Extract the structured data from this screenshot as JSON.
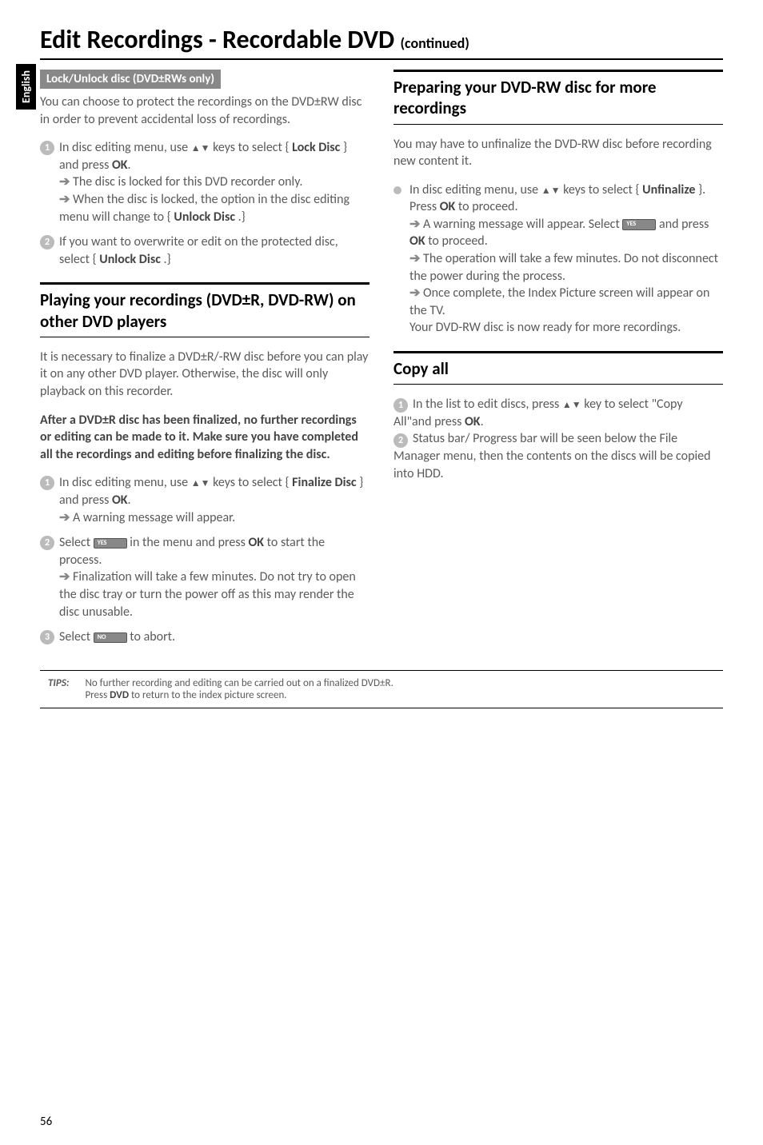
{
  "sideTab": "English",
  "title": "Edit Recordings - Recordable DVD",
  "continued": "(continued)",
  "left": {
    "lockHeader": "Lock/Unlock disc (DVD±RWs only)",
    "lockIntro": "You can choose to protect the recordings on the DVD±RW disc in order to prevent accidental loss of recordings.",
    "step1a": "In disc editing menu, use ",
    "step1b": " keys to select { ",
    "step1c": "Lock Disc",
    "step1d": " } and press ",
    "step1e": "OK",
    "step1f": ".",
    "arrow1a": " The disc is locked for this DVD recorder only.",
    "arrow1b": " When the disc is locked, the option in the disc editing menu will change to { ",
    "arrow1c": "Unlock Disc",
    "arrow1d": " .}",
    "step2a": "If you want to overwrite or edit on the protected disc, select { ",
    "step2b": "Unlock Disc",
    "step2c": " .}",
    "playHeading": "Playing your recordings (DVD±R, DVD-RW) on other DVD players",
    "playIntro": "It is necessary to finalize a DVD±R/-RW disc before you can play it on any other DVD player. Otherwise, the disc will only playback on this recorder.",
    "playBold": "After a DVD±R disc has been finalized, no further recordings or editing can be made to it. Make sure you have completed all the recordings and editing before finalizing the disc.",
    "finStep1a": "In disc editing menu, use ",
    "finStep1b": " keys to select { ",
    "finStep1c": "Finalize Disc",
    "finStep1d": " } and press ",
    "finStep1e": "OK",
    "finArrow1": " A warning message will appear.",
    "finStep2a": "Select ",
    "finStep2b": " in the menu and press ",
    "finStep2c": "OK",
    "finStep2d": " to start the process.",
    "finArrow2": " Finalization will take a few minutes. Do not try to open the disc tray or turn the power off as this may render the disc unusable.",
    "finStep3a": "Select ",
    "finStep3b": " to abort.",
    "yesBtn": "YES",
    "noBtn": "NO"
  },
  "right": {
    "prepHeading": "Preparing your DVD-RW disc for more recordings",
    "prepIntro": "You may have to unfinalize the DVD-RW disc before recording new content it.",
    "prepBullet1a": "In disc editing menu, use ",
    "prepBullet1b": " keys to select { ",
    "prepBullet1c": "Unfinalize",
    "prepBullet1d": " }. Press ",
    "prepBullet1e": "OK",
    "prepBullet1f": " to proceed.",
    "prepArrow1a": " A warning message will appear. Select ",
    "prepArrow1b": " and press ",
    "prepArrow1c": "OK",
    "prepArrow1d": " to proceed.",
    "prepArrow2": " The operation will take a few minutes. Do not disconnect the power during the process.",
    "prepArrow3a": " Once complete, the Index Picture screen will appear on the TV.",
    "prepReady": "Your DVD-RW disc is now ready for more recordings.",
    "copyHeading": "Copy all",
    "copyStep1a": "In the list to edit discs, press ",
    "copyStep1b": " key to select \"Copy All\"and press ",
    "copyStep1c": "OK",
    "copyStep2": "Status bar/ Progress bar will be seen below the File Manager menu, then the contents on the discs will be copied into HDD.",
    "yesBtn": "YES"
  },
  "tips": {
    "label": "TIPS:",
    "line1a": "No further recording and editing can be carried out on a finalized DVD±R.",
    "line2a": "Press ",
    "line2b": "DVD",
    "line2c": " to return to the index picture screen."
  },
  "pageNum": "56"
}
